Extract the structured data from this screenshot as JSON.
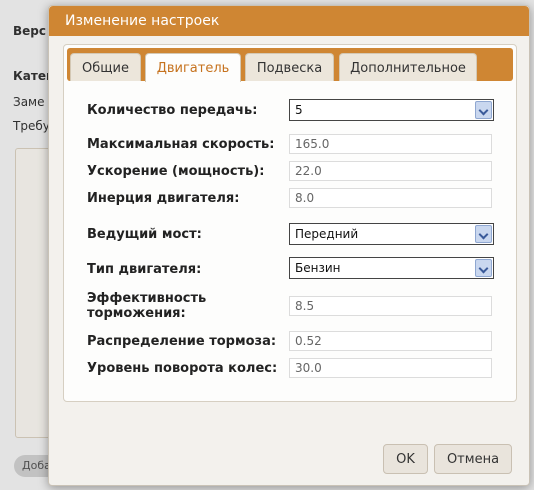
{
  "background": {
    "fragments": [
      "Верс",
      "Катег",
      "Заме",
      "Требу"
    ],
    "button_label": "Доба"
  },
  "dialog": {
    "title": "Изменение настроек",
    "tabs": [
      {
        "label": "Общие",
        "active": false
      },
      {
        "label": "Двигатель",
        "active": true
      },
      {
        "label": "Подвеска",
        "active": false
      },
      {
        "label": "Дополнительное",
        "active": false
      }
    ],
    "fields": {
      "gears": {
        "label": "Количество передачь:",
        "value": "5"
      },
      "max_speed": {
        "label": "Максимальная скорость:",
        "value": "165.0"
      },
      "acceleration": {
        "label": "Ускорение (мощность):",
        "value": "22.0"
      },
      "inertia": {
        "label": "Инерция двигателя:",
        "value": "8.0"
      },
      "drive_axle": {
        "label": "Ведущий мост:",
        "value": "Передний"
      },
      "engine_type": {
        "label": "Тип двигателя:",
        "value": "Бензин"
      },
      "brake_efficiency": {
        "label_line1": "Эффективность",
        "label_line2": "торможения:",
        "value": "8.5"
      },
      "brake_distribution": {
        "label": "Распределение тормоза:",
        "value": "0.52"
      },
      "steering": {
        "label": "Уровень поворота колес:",
        "value": "30.0"
      }
    },
    "buttons": {
      "ok": "OK",
      "cancel": "Отмена"
    }
  },
  "colors": {
    "accent": "#cf8633",
    "active_tab_text": "#c6721e",
    "dialog_bg": "#f3f1ed"
  }
}
